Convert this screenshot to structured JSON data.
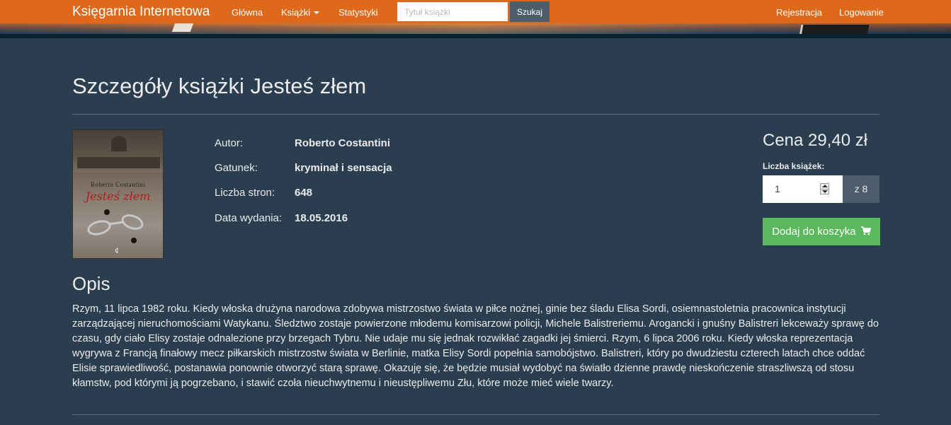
{
  "navbar": {
    "brand": "Księgarnia Internetowa",
    "home": "Główna",
    "books": "Książki",
    "stats": "Statystyki",
    "search_placeholder": "Tytuł książki",
    "search_button": "Szukaj",
    "register": "Rejestracja",
    "login": "Logowanie"
  },
  "page": {
    "title": "Szczegóły książki Jesteś złem"
  },
  "cover": {
    "author": "Roberto Costantini",
    "title": "Jesteś złem",
    "publisher_mark": "¢"
  },
  "details": [
    {
      "label": "Autor:",
      "value": "Roberto Costantini"
    },
    {
      "label": "Gatunek:",
      "value": "kryminał i sensacja"
    },
    {
      "label": "Liczba stron:",
      "value": "648"
    },
    {
      "label": "Data wydania:",
      "value": "18.05.2016"
    }
  ],
  "purchase": {
    "price": "Cena 29,40 zł",
    "quantity_label": "Liczba książek:",
    "quantity_value": "1",
    "available": "z 8",
    "add_button": "Dodaj do koszyka"
  },
  "description": {
    "heading": "Opis",
    "text": "Rzym, 11 lipca 1982 roku. Kiedy włoska drużyna narodowa zdobywa mistrzostwo świata w piłce nożnej, ginie bez śladu Elisa Sordi, osiemnastoletnia pracownica instytucji zarządzającej nieruchomościami Watykanu. Śledztwo zostaje powierzone młodemu komisarzowi policji, Michele Balistreriemu. Arogancki i gnuśny Balistreri lekceważy sprawę do czasu, gdy ciało Elisy zostaje odnalezione przy brzegach Tybru. Nie udaje mu się jednak rozwikłać zagadki jej śmierci. Rzym, 6 lipca 2006 roku. Kiedy włoska reprezentacja wygrywa z Francją finałowy mecz piłkarskich mistrzostw świata w Berlinie, matka Elisy Sordi popełnia samobójstwo. Balistreri, który po dwudziestu czterech latach chce oddać Elisie sprawiedliwość, postanawia ponownie otworzyć starą sprawę. Okazuję się, że będzie musiał wydobyć na światło dzienne prawdę nieskończenie straszliwszą od stosu kłamstw, pod którymi ją pogrzebano, i stawić czoła nieuchwytnemu i nieustępliwemu Złu, które może mieć wiele twarzy."
  },
  "colors": {
    "navbar": "#df691a",
    "background": "#2b3e50",
    "addon": "#4e5d6c",
    "success": "#5cb85c"
  }
}
